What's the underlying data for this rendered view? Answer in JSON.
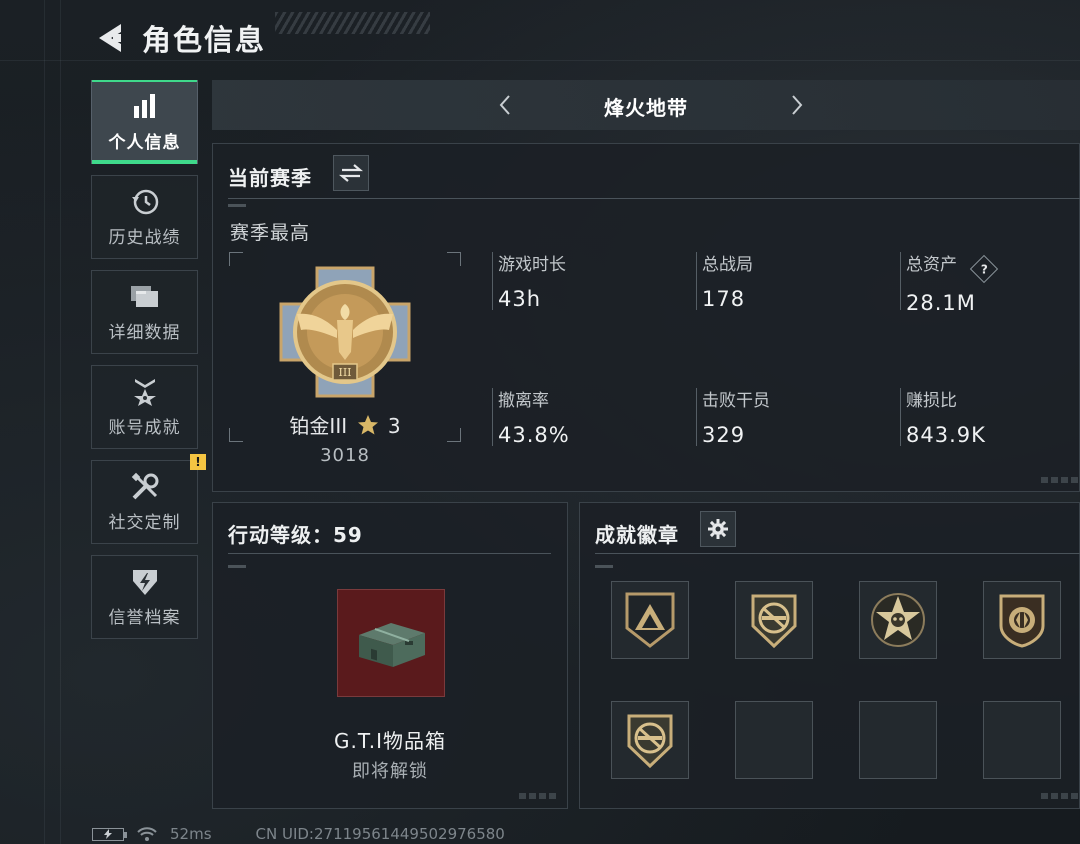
{
  "header": {
    "title": "角色信息",
    "back_icon": "back-arrow-icon"
  },
  "sidebar": {
    "items": [
      {
        "label": "个人信息",
        "icon": "bar-chart-icon",
        "active": true
      },
      {
        "label": "历史战绩",
        "icon": "history-clock-icon"
      },
      {
        "label": "详细数据",
        "icon": "folder-stack-icon"
      },
      {
        "label": "账号成就",
        "icon": "achievement-star-icon"
      },
      {
        "label": "社交定制",
        "icon": "wrench-tools-icon",
        "badge": "!"
      },
      {
        "label": "信誉档案",
        "icon": "shield-bolt-icon"
      }
    ]
  },
  "mode": {
    "title": "烽火地带"
  },
  "season": {
    "title": "当前赛季",
    "best_label": "赛季最高",
    "rank_name": "铂金III",
    "rank_stars": "3",
    "rank_score": "3018",
    "stats": [
      {
        "label": "游戏时长",
        "value": "43h"
      },
      {
        "label": "总战局",
        "value": "178"
      },
      {
        "label": "总资产",
        "value": "28.1M",
        "help": "?"
      },
      {
        "label": "撤离率",
        "value": "43.8%"
      },
      {
        "label": "击败干员",
        "value": "329"
      },
      {
        "label": "赚损比",
        "value": "843.9K"
      }
    ]
  },
  "action_level": {
    "title": "行动等级：59",
    "reward_name": "G.T.I物品箱",
    "reward_status": "即将解锁"
  },
  "achievements": {
    "title": "成就徽章",
    "medals": [
      "triangle-medal-icon",
      "rifle-cross-medal-icon",
      "star-skull-medal-icon",
      "shield-emblem-medal-icon",
      "rifle-cross-medal-icon",
      "",
      "",
      ""
    ]
  },
  "status": {
    "ping": "52ms",
    "uid": "CN UID:27119561449502976580"
  },
  "colors": {
    "accent": "#3fd98b",
    "warning": "#f5c542",
    "reward_bg": "#5a1a1c"
  }
}
